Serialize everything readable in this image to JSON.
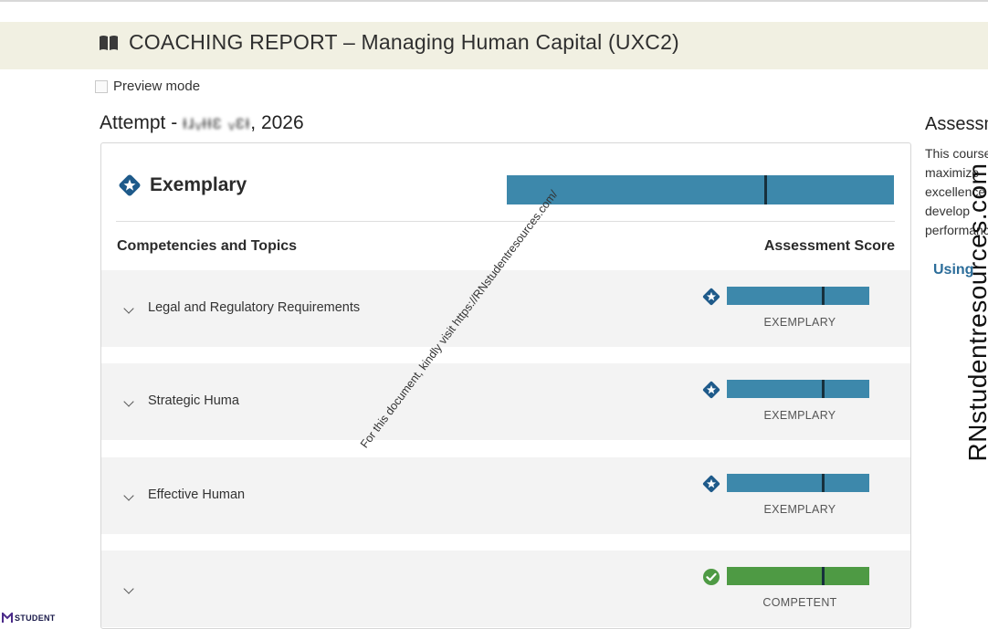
{
  "header": {
    "title": "COACHING REPORT – Managing Human Capital (UXC2)",
    "icon": "book-icon"
  },
  "preview": {
    "label": "Preview mode"
  },
  "attempt": {
    "prefix": "Attempt - ",
    "date_obscured": "ᵻɹᵥᵼᵼɛ ᵥɛᵼ",
    "year": ", 2026"
  },
  "overall": {
    "label": "Exemplary",
    "fill_percent": 100,
    "icon": "star-badge-icon",
    "color": "#3d88ab"
  },
  "columns": {
    "left": "Competencies and Topics",
    "right": "Assessment Score"
  },
  "competencies": [
    {
      "label": "Legal and Regulatory Requirements",
      "status": "EXEMPLARY",
      "icon": "star-badge-icon",
      "fill_percent": 100,
      "color": "#3d88ab"
    },
    {
      "label": "Strategic Huma",
      "status": "EXEMPLARY",
      "icon": "star-badge-icon",
      "fill_percent": 100,
      "color": "#3d88ab"
    },
    {
      "label": "Effective Human",
      "status": "EXEMPLARY",
      "icon": "star-badge-icon",
      "fill_percent": 100,
      "color": "#3d88ab"
    },
    {
      "label": "",
      "status": "COMPETENT",
      "icon": "check-circle-icon",
      "fill_percent": 100,
      "color": "#4e9a44"
    }
  ],
  "sidebar": {
    "title": "Assessment",
    "text": "This course maximize excellence and develop performance",
    "link": "Using"
  },
  "watermarks": {
    "vertical": "RNstudentresources.com",
    "diagonal": "For this document, kindly visit https://RNstudentresources.com/",
    "logo": "STUDENT"
  }
}
